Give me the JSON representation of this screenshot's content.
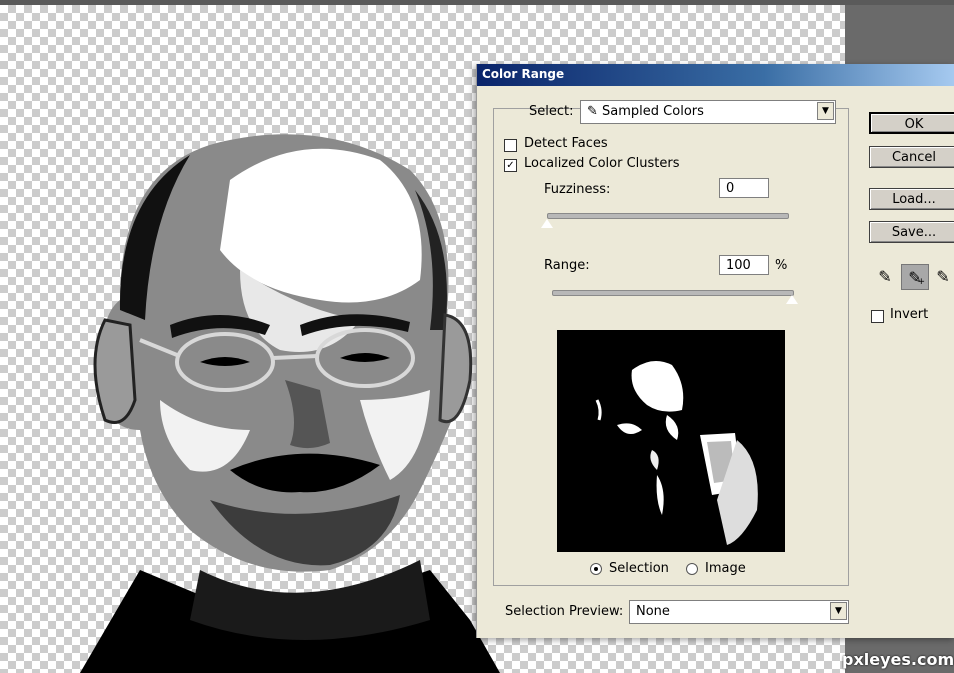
{
  "dialog": {
    "title": "Color Range",
    "select_label": "Select:",
    "select_value": "Sampled Colors",
    "detect_faces_label": "Detect Faces",
    "detect_faces_checked": false,
    "localized_label": "Localized Color Clusters",
    "localized_checked": true,
    "localized_mark": "✓",
    "fuzziness_label": "Fuzziness:",
    "fuzziness_value": "0",
    "fuzziness_level": 0,
    "range_label": "Range:",
    "range_value": "100",
    "range_unit": "%",
    "range_level": 100,
    "radio_selection_label": "Selection",
    "radio_image_label": "Image",
    "selected_radio": "Selection",
    "preview_label": "Selection Preview:",
    "preview_value": "None",
    "buttons": {
      "ok": "OK",
      "cancel": "Cancel",
      "load": "Load...",
      "save": "Save..."
    },
    "invert_label": "Invert",
    "invert_checked": false,
    "tools": [
      "eyedropper-icon",
      "eyedropper-plus-icon",
      "eyedropper-minus-icon"
    ],
    "active_tool": "eyedropper-plus-icon"
  },
  "watermark": "pxleyes.com",
  "colors": {
    "title_start": "#0a246a",
    "title_end": "#a6caf0",
    "dialog_bg": "#ece9d8"
  }
}
